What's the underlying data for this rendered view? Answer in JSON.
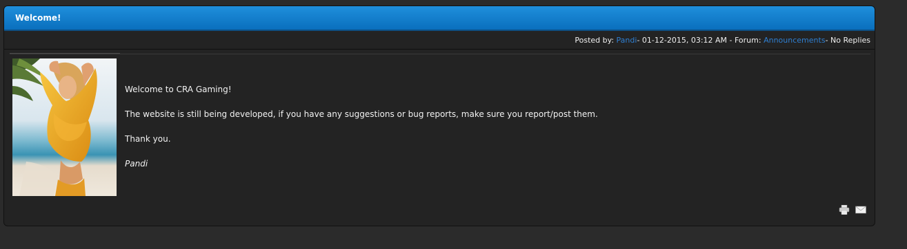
{
  "post": {
    "title": "Welcome!",
    "meta": {
      "posted_by_label": "Posted by:",
      "author": "Pandi",
      "date_sep": " - 01-12-2015, 03:12 AM - Forum:",
      "forum": "Announcements",
      "replies": " - No Replies"
    },
    "body": {
      "line1": "Welcome to CRA Gaming!",
      "line2": "The website is still being developed, if you have any suggestions or bug reports, make sure you report/post them.",
      "line3": "Thank you.",
      "signature": "Pandi"
    },
    "tools": {
      "print_icon": "printer-icon",
      "email_icon": "envelope-icon"
    }
  },
  "colors": {
    "header_blue": "#0a6fbd",
    "link_blue": "#2f7fd1",
    "panel_bg": "#232323",
    "page_bg": "#2b2b2b"
  }
}
